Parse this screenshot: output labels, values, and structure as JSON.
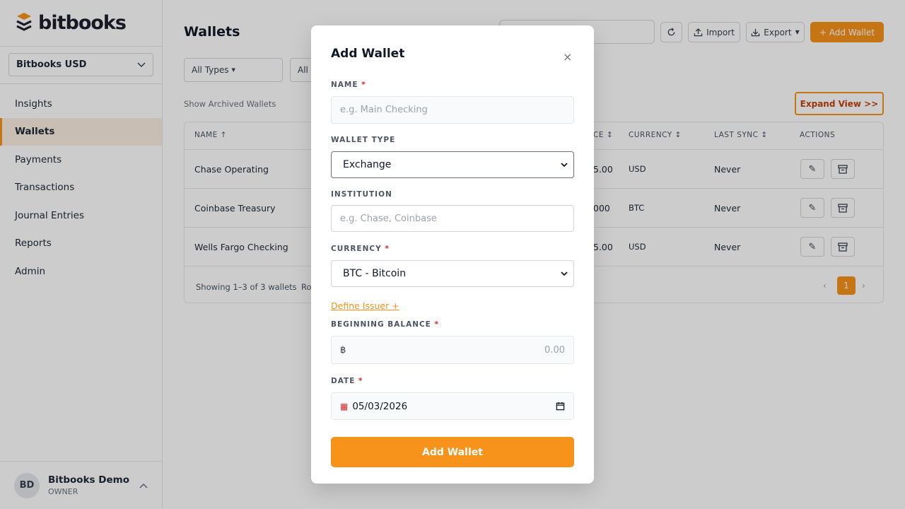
{
  "brand": {
    "name": "bitbooks",
    "accent": "#f7931a"
  },
  "org_select": {
    "value": "Bitbooks USD"
  },
  "nav": [
    {
      "label": "Insights"
    },
    {
      "label": "Wallets",
      "active": true
    },
    {
      "label": "Payments"
    },
    {
      "label": "Transactions"
    },
    {
      "label": "Journal Entries"
    },
    {
      "label": "Reports"
    },
    {
      "label": "Admin"
    }
  ],
  "user": {
    "initials": "BD",
    "name": "Bitbooks Demo",
    "role": "OWNER"
  },
  "page": {
    "title": "Wallets"
  },
  "toolbar": {
    "import_label": "Import",
    "export_label": "Export",
    "add_label": "+ Add Wallet"
  },
  "filters": {
    "types": "All Types",
    "second": "All"
  },
  "show_archived": "Show Archived Wallets",
  "expand_label": "Expand View >>",
  "table": {
    "headers": {
      "name": "NAME",
      "balance_tail": "CE",
      "currency": "CURRENCY",
      "last_sync": "LAST SYNC",
      "actions": "ACTIONS"
    },
    "rows": [
      {
        "name": "Chase Operating",
        "balance_tail": "5.00",
        "currency": "USD",
        "last_sync": "Never"
      },
      {
        "name": "Coinbase Treasury",
        "balance_tail": "000",
        "currency": "BTC",
        "last_sync": "Never"
      },
      {
        "name": "Wells Fargo Checking",
        "balance_tail": "5.00",
        "currency": "USD",
        "last_sync": "Never"
      }
    ],
    "showing": "Showing 1–3 of 3 wallets",
    "rows_label": "Ro",
    "current_page": "1"
  },
  "modal": {
    "title": "Add Wallet",
    "close": "×",
    "name_label": "NAME",
    "name_placeholder": "e.g. Main Checking",
    "type_label": "WALLET TYPE",
    "type_value": "Exchange",
    "institution_label": "INSTITUTION",
    "institution_placeholder": "e.g. Chase, Coinbase",
    "currency_label": "CURRENCY",
    "currency_value": "BTC - Bitcoin",
    "define_issuer": "Define Issuer +",
    "balance_label": "BEGINNING BALANCE",
    "balance_symbol": "฿",
    "balance_placeholder": "0.00",
    "date_label": "DATE",
    "date_value": "05/03/2026",
    "submit_label": "Add Wallet",
    "required_mark": "*"
  }
}
